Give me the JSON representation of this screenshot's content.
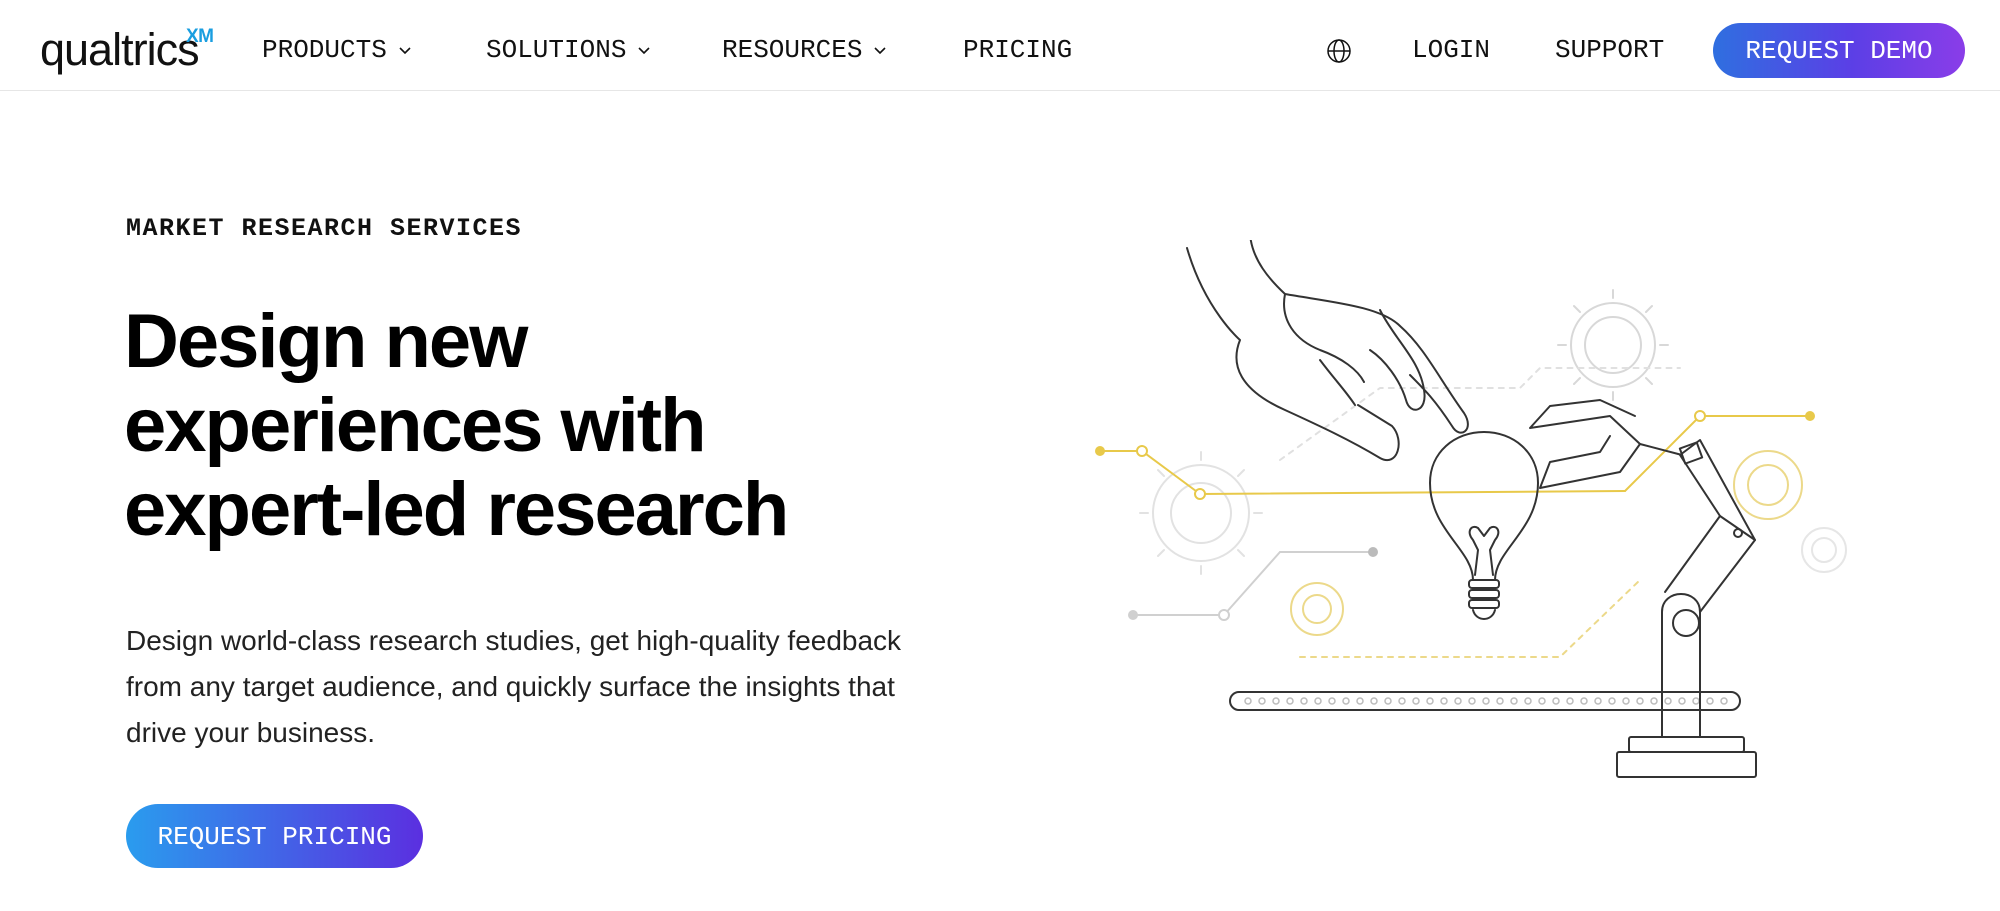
{
  "brand": {
    "name": "qualtrics",
    "mark": "XM",
    "accent": "#1a9ee0"
  },
  "nav": {
    "items": [
      {
        "label": "PRODUCTS",
        "icon": "chevron-down-icon"
      },
      {
        "label": "SOLUTIONS",
        "icon": "chevron-down-icon"
      },
      {
        "label": "RESOURCES",
        "icon": "chevron-down-icon"
      },
      {
        "label": "PRICING"
      }
    ],
    "globe_icon": "globe-icon",
    "login": "LOGIN",
    "support": "SUPPORT",
    "cta": "REQUEST DEMO"
  },
  "hero": {
    "eyebrow": "MARKET RESEARCH SERVICES",
    "headline_lines": [
      "Design new",
      "experiences with",
      "expert-led research"
    ],
    "body_lines": [
      "Design world-class research studies, get high-quality feedback",
      "from any target audience, and quickly surface the insights that",
      "drive your business."
    ],
    "cta": "REQUEST PRICING"
  },
  "colors": {
    "cta_gradient": [
      "#2f6fe0",
      "#8a3de8"
    ],
    "pricing_gradient": [
      "#2a9cee",
      "#5b2fe0"
    ],
    "illustration_yellow": "#e8c94a"
  }
}
